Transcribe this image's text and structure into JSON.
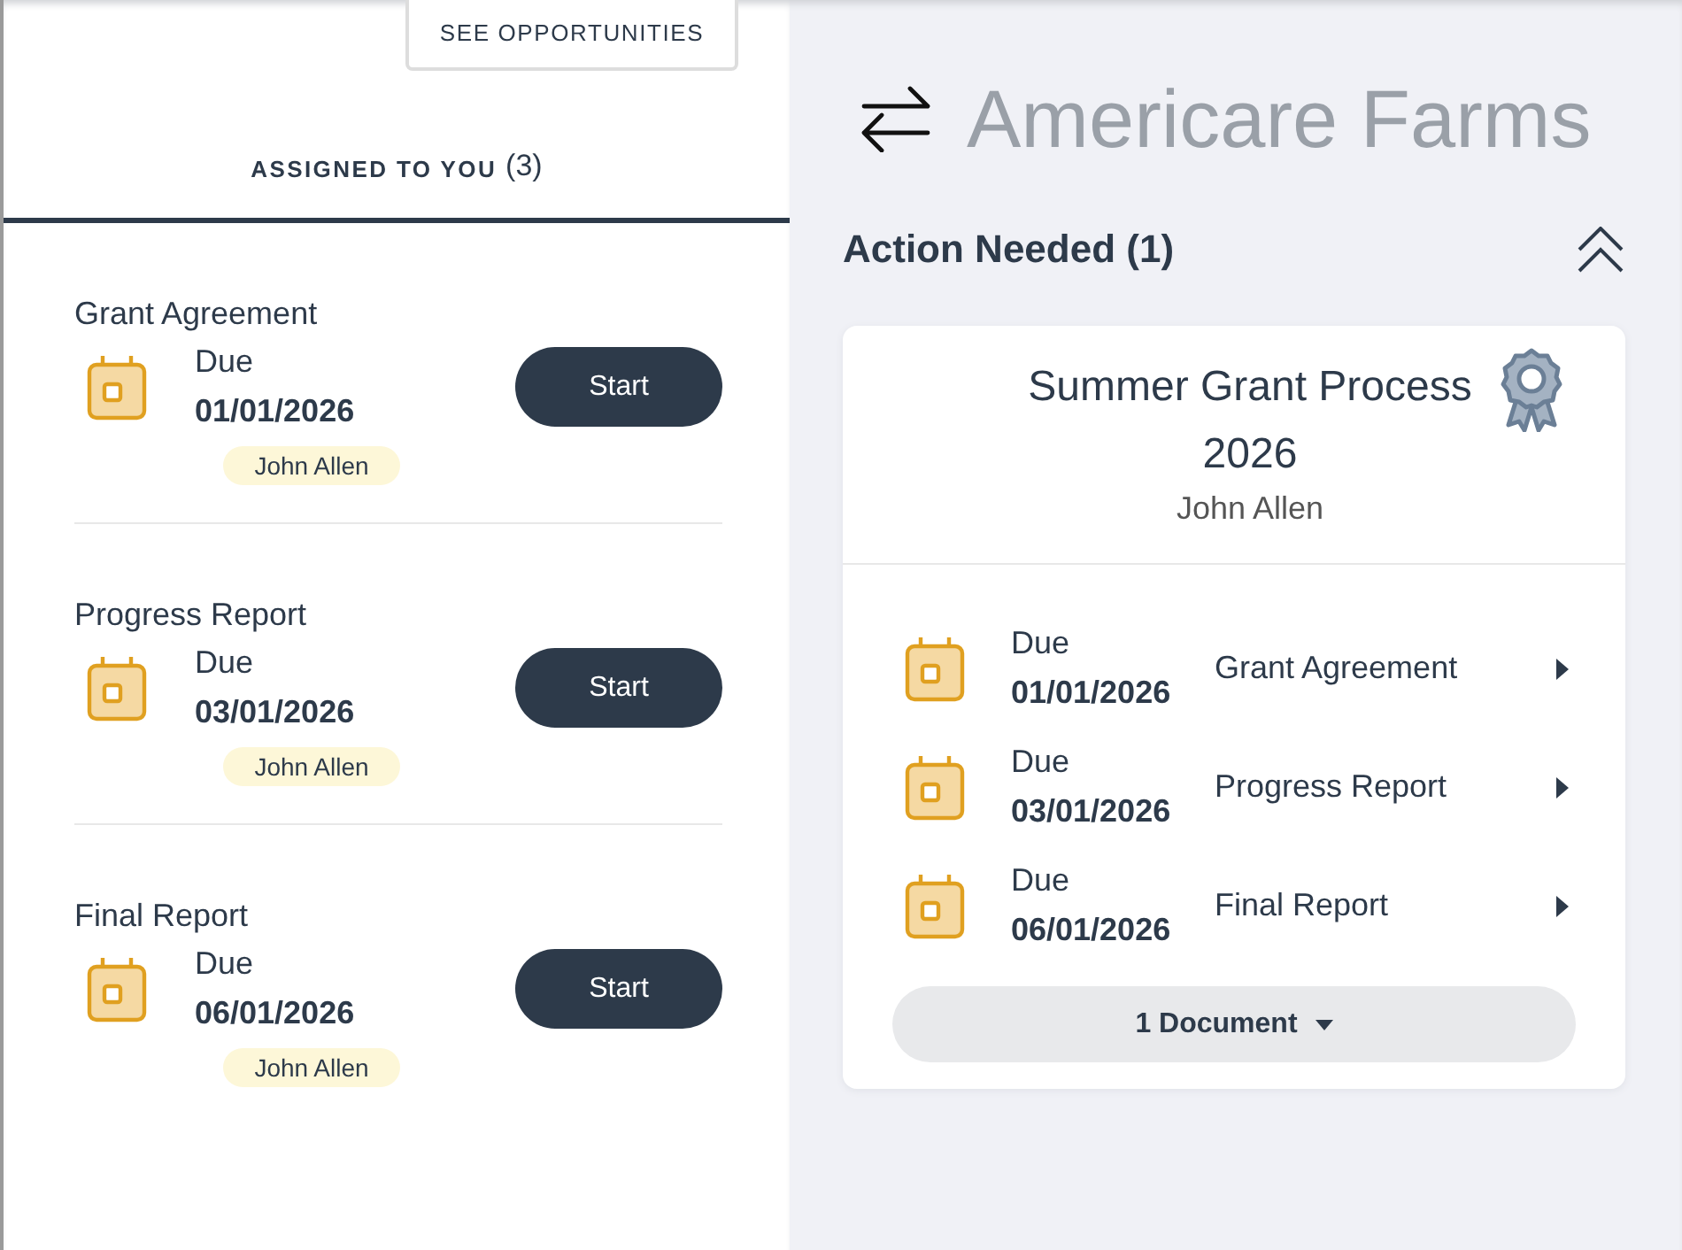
{
  "left_panel": {
    "see_opportunities_button": "SEE OPPORTUNITIES",
    "tab": {
      "label": "ASSIGNED TO YOU",
      "count": "(3)",
      "selected": true
    },
    "tasks": [
      {
        "title": "Grant Agreement",
        "due_label": "Due",
        "due_date": "01/01/2026",
        "action": "Start",
        "assignee": "John Allen"
      },
      {
        "title": "Progress Report",
        "due_label": "Due",
        "due_date": "03/01/2026",
        "action": "Start",
        "assignee": "John Allen"
      },
      {
        "title": "Final Report",
        "due_label": "Due",
        "due_date": "06/01/2026",
        "action": "Start",
        "assignee": "John Allen"
      }
    ]
  },
  "right_panel": {
    "organization": "Americare Farms",
    "section": {
      "title": "Action Needed (1)",
      "expanded": true
    },
    "card": {
      "title": "Summer Grant Process 2026",
      "owner": "John Allen",
      "steps": [
        {
          "due_label": "Due",
          "due_date": "01/01/2026",
          "name": "Grant Agreement"
        },
        {
          "due_label": "Due",
          "due_date": "03/01/2026",
          "name": "Progress Report"
        },
        {
          "due_label": "Due",
          "due_date": "06/01/2026",
          "name": "Final Report"
        }
      ],
      "documents_button": "1 Document"
    }
  }
}
